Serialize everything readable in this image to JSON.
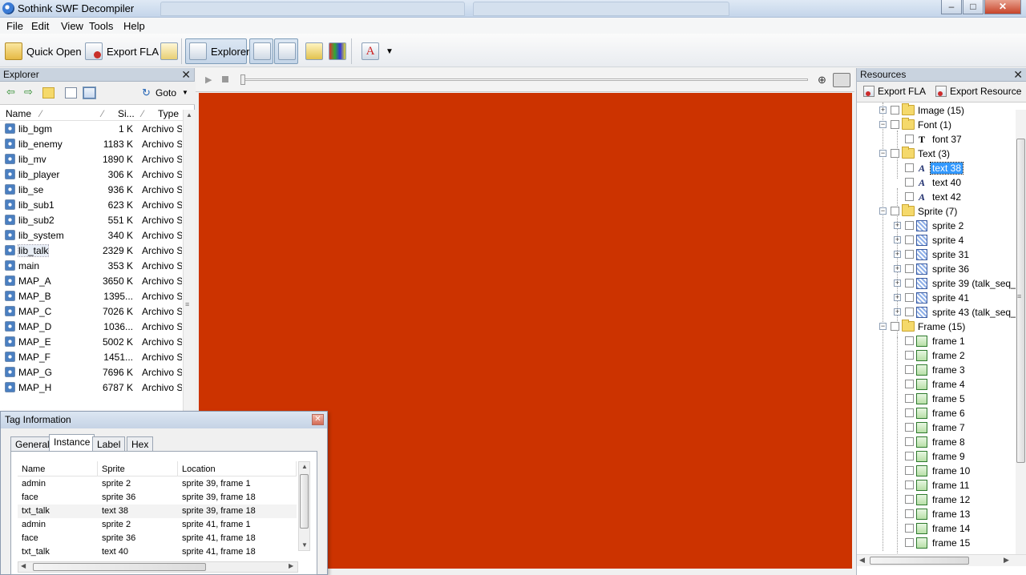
{
  "window": {
    "title": "Sothink SWF Decompiler"
  },
  "menu": [
    "File",
    "Edit",
    "View",
    "Tools",
    "Help"
  ],
  "toolbar": {
    "quick_open": "Quick Open",
    "export_fla": "Export FLA",
    "explorer": "Explorer"
  },
  "explorer": {
    "title": "Explorer",
    "goto": "Goto",
    "columns": {
      "name": "Name",
      "size": "Si...",
      "type": "Type"
    },
    "files": [
      {
        "name": "lib_bgm",
        "size": "1 K",
        "type": "Archivo S"
      },
      {
        "name": "lib_enemy",
        "size": "1183 K",
        "type": "Archivo S"
      },
      {
        "name": "lib_mv",
        "size": "1890 K",
        "type": "Archivo S"
      },
      {
        "name": "lib_player",
        "size": "306 K",
        "type": "Archivo S"
      },
      {
        "name": "lib_se",
        "size": "936 K",
        "type": "Archivo S"
      },
      {
        "name": "lib_sub1",
        "size": "623 K",
        "type": "Archivo S"
      },
      {
        "name": "lib_sub2",
        "size": "551 K",
        "type": "Archivo S"
      },
      {
        "name": "lib_system",
        "size": "340 K",
        "type": "Archivo S"
      },
      {
        "name": "lib_talk",
        "size": "2329 K",
        "type": "Archivo S"
      },
      {
        "name": "main",
        "size": "353 K",
        "type": "Archivo S"
      },
      {
        "name": "MAP_A",
        "size": "3650 K",
        "type": "Archivo S"
      },
      {
        "name": "MAP_B",
        "size": "1395...",
        "type": "Archivo S"
      },
      {
        "name": "MAP_C",
        "size": "7026 K",
        "type": "Archivo S"
      },
      {
        "name": "MAP_D",
        "size": "1036...",
        "type": "Archivo S"
      },
      {
        "name": "MAP_E",
        "size": "5002 K",
        "type": "Archivo S"
      },
      {
        "name": "MAP_F",
        "size": "1451...",
        "type": "Archivo S"
      },
      {
        "name": "MAP_G",
        "size": "7696 K",
        "type": "Archivo S"
      },
      {
        "name": "MAP_H",
        "size": "6787 K",
        "type": "Archivo S"
      }
    ]
  },
  "stage": {
    "color": "#cc3300"
  },
  "resources": {
    "title": "Resources",
    "export_fla": "Export FLA",
    "export_resource": "Export Resource",
    "tree": [
      {
        "label": "Image (15)",
        "kind": "folder",
        "level": 0,
        "expand": "+"
      },
      {
        "label": "Font (1)",
        "kind": "folder",
        "level": 0,
        "expand": "-"
      },
      {
        "label": "font 37",
        "kind": "font",
        "level": 1
      },
      {
        "label": "Text (3)",
        "kind": "folder",
        "level": 0,
        "expand": "-"
      },
      {
        "label": "text 38",
        "kind": "text",
        "level": 1,
        "selected": true
      },
      {
        "label": "text 40",
        "kind": "text",
        "level": 1
      },
      {
        "label": "text 42",
        "kind": "text",
        "level": 1
      },
      {
        "label": "Sprite (7)",
        "kind": "folder",
        "level": 0,
        "expand": "-"
      },
      {
        "label": "sprite 2",
        "kind": "sprite",
        "level": 1,
        "expand": "+"
      },
      {
        "label": "sprite 4",
        "kind": "sprite",
        "level": 1,
        "expand": "+"
      },
      {
        "label": "sprite 31",
        "kind": "sprite",
        "level": 1,
        "expand": "+"
      },
      {
        "label": "sprite 36",
        "kind": "sprite",
        "level": 1,
        "expand": "+"
      },
      {
        "label": "sprite 39 (talk_seq_",
        "kind": "sprite",
        "level": 1,
        "expand": "+"
      },
      {
        "label": "sprite 41",
        "kind": "sprite",
        "level": 1,
        "expand": "+"
      },
      {
        "label": "sprite 43 (talk_seq_",
        "kind": "sprite",
        "level": 1,
        "expand": "+"
      },
      {
        "label": "Frame (15)",
        "kind": "folder",
        "level": 0,
        "expand": "-"
      },
      {
        "label": "frame 1",
        "kind": "frame",
        "level": 1
      },
      {
        "label": "frame 2",
        "kind": "frame",
        "level": 1
      },
      {
        "label": "frame 3",
        "kind": "frame",
        "level": 1
      },
      {
        "label": "frame 4",
        "kind": "frame",
        "level": 1
      },
      {
        "label": "frame 5",
        "kind": "frame",
        "level": 1
      },
      {
        "label": "frame 6",
        "kind": "frame",
        "level": 1
      },
      {
        "label": "frame 7",
        "kind": "frame",
        "level": 1
      },
      {
        "label": "frame 8",
        "kind": "frame",
        "level": 1
      },
      {
        "label": "frame 9",
        "kind": "frame",
        "level": 1
      },
      {
        "label": "frame 10",
        "kind": "frame",
        "level": 1
      },
      {
        "label": "frame 11",
        "kind": "frame",
        "level": 1
      },
      {
        "label": "frame 12",
        "kind": "frame",
        "level": 1
      },
      {
        "label": "frame 13",
        "kind": "frame",
        "level": 1
      },
      {
        "label": "frame 14",
        "kind": "frame",
        "level": 1
      },
      {
        "label": "frame 15",
        "kind": "frame",
        "level": 1
      }
    ]
  },
  "tag_info": {
    "title": "Tag Information",
    "tabs": [
      "General",
      "Instance",
      "Label",
      "Hex"
    ],
    "active_tab": "Instance",
    "columns": [
      "Name",
      "Sprite",
      "Location"
    ],
    "rows": [
      [
        "admin",
        "sprite 2",
        "sprite 39, frame 1"
      ],
      [
        "face",
        "sprite 36",
        "sprite 39, frame 18"
      ],
      [
        "txt_talk",
        "text 38",
        "sprite 39, frame 18"
      ],
      [
        "admin",
        "sprite 2",
        "sprite 41, frame 1"
      ],
      [
        "face",
        "sprite 36",
        "sprite 41, frame 18"
      ],
      [
        "txt_talk",
        "text 40",
        "sprite 41, frame 18"
      ]
    ]
  }
}
